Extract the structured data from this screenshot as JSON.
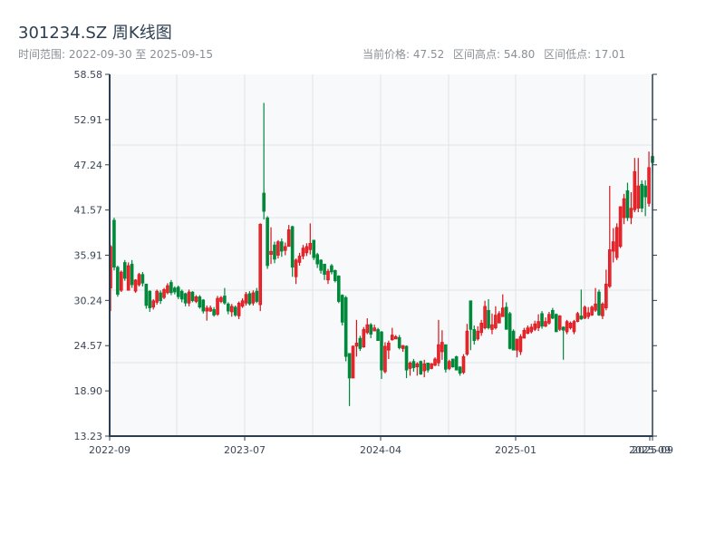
{
  "header": {
    "title": "301234.SZ 周K线图",
    "range_label": "时间范围: 2022-09-30 至 2025-09-15",
    "current_price": "当前价格: 47.52",
    "range_high": "区间高点: 54.80",
    "range_low": "区间低点: 17.01"
  },
  "chart_data": {
    "type": "candlestick",
    "title": "301234.SZ 周K线图",
    "interval": "weekly",
    "date_range": [
      "2022-09-30",
      "2025-09-15"
    ],
    "colors": {
      "up": "#d7141a",
      "down": "#00893a",
      "plot_bg": "#f7f9fb",
      "grid": "#e1e4e8",
      "axis": "#2c3e50"
    },
    "ylim": [
      13.23,
      58.58
    ],
    "y_ticks": [
      "13.23",
      "18.90",
      "24.57",
      "30.24",
      "35.91",
      "41.57",
      "47.24",
      "52.91",
      "58.58"
    ],
    "x_ticks": [
      "2022-09",
      "2023-07",
      "2024-04",
      "2025-01",
      "2025-09",
      "2025-09"
    ],
    "grid": true,
    "fields": [
      "open",
      "high",
      "low",
      "close"
    ],
    "candles": [
      [
        31.8,
        37.2,
        28.9,
        37.0
      ],
      [
        40.3,
        40.6,
        34.0,
        34.4
      ],
      [
        34.4,
        34.6,
        30.7,
        31.0
      ],
      [
        31.5,
        34.0,
        31.3,
        33.8
      ],
      [
        35.0,
        35.3,
        32.7,
        33.0
      ],
      [
        31.5,
        35.0,
        31.5,
        34.6
      ],
      [
        34.8,
        35.3,
        31.8,
        32.2
      ],
      [
        31.4,
        32.9,
        31.2,
        32.8
      ],
      [
        32.2,
        33.7,
        32.0,
        33.5
      ],
      [
        33.5,
        33.8,
        32.0,
        32.4
      ],
      [
        32.3,
        32.3,
        29.2,
        29.6
      ],
      [
        31.4,
        31.5,
        28.8,
        29.3
      ],
      [
        29.4,
        30.4,
        29.1,
        30.2
      ],
      [
        30.0,
        31.6,
        29.7,
        31.4
      ],
      [
        31.2,
        31.5,
        29.8,
        30.2
      ],
      [
        30.6,
        31.8,
        30.4,
        31.6
      ],
      [
        31.2,
        32.4,
        31.0,
        32.1
      ],
      [
        32.5,
        32.8,
        30.9,
        31.2
      ],
      [
        31.8,
        32.0,
        31.0,
        31.3
      ],
      [
        31.9,
        32.1,
        30.4,
        30.7
      ],
      [
        31.4,
        31.6,
        30.0,
        30.4
      ],
      [
        31.1,
        31.2,
        29.5,
        29.9
      ],
      [
        29.9,
        31.6,
        29.5,
        31.3
      ],
      [
        31.3,
        31.4,
        30.0,
        30.2
      ],
      [
        30.1,
        30.9,
        29.9,
        30.7
      ],
      [
        30.7,
        30.9,
        29.2,
        29.4
      ],
      [
        30.3,
        30.4,
        28.6,
        28.9
      ],
      [
        28.9,
        29.6,
        27.7,
        29.3
      ],
      [
        28.9,
        29.6,
        28.8,
        29.3
      ],
      [
        29.1,
        29.4,
        28.2,
        28.4
      ],
      [
        28.5,
        30.8,
        28.3,
        30.5
      ],
      [
        30.1,
        30.8,
        29.9,
        30.6
      ],
      [
        30.8,
        31.8,
        29.7,
        29.9
      ],
      [
        29.8,
        30.0,
        28.5,
        28.9
      ],
      [
        28.8,
        29.8,
        28.2,
        29.5
      ],
      [
        29.4,
        29.6,
        28.2,
        28.4
      ],
      [
        28.3,
        30.1,
        27.9,
        29.9
      ],
      [
        29.5,
        30.5,
        29.3,
        30.2
      ],
      [
        29.9,
        31.3,
        29.6,
        31.0
      ],
      [
        31.1,
        31.4,
        29.6,
        29.8
      ],
      [
        29.9,
        31.5,
        29.6,
        31.2
      ],
      [
        31.4,
        31.8,
        29.9,
        30.1
      ],
      [
        29.7,
        39.9,
        28.9,
        39.8
      ],
      [
        43.7,
        55.0,
        40.4,
        41.4
      ],
      [
        40.6,
        40.8,
        34.2,
        34.6
      ],
      [
        36.0,
        39.4,
        34.8,
        36.4
      ],
      [
        37.2,
        37.6,
        34.9,
        35.4
      ],
      [
        35.9,
        37.8,
        35.5,
        37.6
      ],
      [
        37.6,
        38.0,
        35.7,
        36.4
      ],
      [
        36.5,
        37.5,
        35.9,
        37.0
      ],
      [
        37.0,
        39.7,
        37.0,
        39.1
      ],
      [
        39.5,
        39.6,
        33.2,
        34.4
      ],
      [
        33.2,
        35.5,
        32.3,
        35.3
      ],
      [
        35.0,
        36.2,
        34.6,
        35.8
      ],
      [
        35.8,
        37.2,
        35.4,
        36.8
      ],
      [
        36.2,
        37.4,
        35.8,
        37.0
      ],
      [
        36.6,
        39.9,
        36.0,
        37.4
      ],
      [
        37.8,
        37.8,
        35.3,
        35.6
      ],
      [
        36.0,
        36.2,
        34.3,
        34.8
      ],
      [
        35.3,
        35.4,
        33.6,
        34.0
      ],
      [
        34.8,
        34.8,
        32.8,
        33.5
      ],
      [
        32.8,
        34.2,
        32.3,
        33.9
      ],
      [
        34.6,
        34.8,
        33.5,
        33.8
      ],
      [
        34.0,
        34.1,
        32.5,
        32.7
      ],
      [
        33.3,
        33.4,
        29.9,
        30.1
      ],
      [
        30.9,
        31.0,
        27.1,
        27.5
      ],
      [
        30.6,
        30.8,
        22.6,
        23.2
      ],
      [
        23.6,
        23.6,
        17.0,
        20.5
      ],
      [
        20.5,
        24.6,
        20.5,
        24.5
      ],
      [
        24.5,
        27.8,
        23.2,
        24.9
      ],
      [
        25.5,
        25.8,
        23.9,
        24.2
      ],
      [
        24.4,
        26.9,
        24.3,
        26.6
      ],
      [
        26.2,
        28.0,
        26.0,
        27.2
      ],
      [
        27.2,
        27.4,
        25.5,
        26.0
      ],
      [
        26.4,
        27.2,
        26.4,
        26.8
      ],
      [
        26.6,
        26.8,
        25.2,
        25.2
      ],
      [
        26.3,
        26.4,
        20.4,
        21.5
      ],
      [
        21.3,
        25.0,
        21.1,
        24.5
      ],
      [
        24.0,
        25.2,
        22.9,
        24.9
      ],
      [
        25.3,
        26.8,
        25.2,
        25.9
      ],
      [
        25.4,
        25.9,
        25.4,
        25.7
      ],
      [
        25.6,
        25.9,
        24.1,
        24.3
      ],
      [
        24.2,
        24.6,
        23.8,
        24.6
      ],
      [
        24.5,
        24.6,
        20.5,
        21.5
      ],
      [
        21.7,
        22.6,
        20.8,
        22.4
      ],
      [
        22.6,
        22.9,
        21.3,
        21.8
      ],
      [
        21.9,
        22.5,
        20.8,
        22.3
      ],
      [
        22.6,
        22.7,
        20.9,
        21.0
      ],
      [
        21.4,
        22.8,
        20.6,
        22.3
      ],
      [
        22.4,
        22.4,
        21.2,
        21.5
      ],
      [
        21.7,
        22.4,
        21.6,
        22.3
      ],
      [
        22.1,
        23.1,
        22.0,
        22.9
      ],
      [
        22.4,
        27.8,
        22.0,
        24.7
      ],
      [
        23.8,
        26.5,
        22.8,
        25.0
      ],
      [
        24.7,
        24.7,
        21.2,
        21.6
      ],
      [
        21.7,
        22.8,
        21.5,
        22.6
      ],
      [
        22.9,
        22.9,
        21.8,
        21.9
      ],
      [
        23.2,
        23.3,
        21.5,
        21.5
      ],
      [
        21.9,
        22.0,
        20.8,
        21.1
      ],
      [
        21.2,
        23.5,
        21.0,
        23.2
      ],
      [
        23.5,
        27.3,
        23.3,
        26.4
      ],
      [
        30.2,
        30.2,
        24.0,
        26.6
      ],
      [
        26.6,
        27.1,
        24.7,
        25.2
      ],
      [
        25.4,
        27.0,
        25.2,
        26.4
      ],
      [
        26.2,
        27.8,
        25.8,
        27.4
      ],
      [
        26.8,
        30.2,
        26.6,
        29.5
      ],
      [
        29.0,
        30.4,
        26.6,
        26.8
      ],
      [
        26.6,
        28.6,
        26.0,
        27.2
      ],
      [
        26.8,
        29.5,
        26.6,
        28.4
      ],
      [
        27.4,
        28.9,
        27.4,
        28.6
      ],
      [
        28.2,
        31.0,
        28.2,
        29.3
      ],
      [
        29.4,
        30.0,
        26.6,
        26.6
      ],
      [
        28.6,
        28.8,
        24.1,
        24.2
      ],
      [
        26.4,
        26.6,
        24.0,
        24.0
      ],
      [
        24.0,
        25.4,
        23.1,
        25.4
      ],
      [
        23.8,
        26.0,
        23.4,
        25.7
      ],
      [
        25.5,
        26.8,
        25.5,
        26.5
      ],
      [
        26.1,
        27.1,
        26.0,
        26.8
      ],
      [
        26.3,
        27.3,
        26.1,
        26.9
      ],
      [
        26.6,
        27.7,
        26.4,
        27.3
      ],
      [
        26.8,
        28.5,
        26.4,
        27.6
      ],
      [
        28.6,
        28.9,
        26.7,
        27.0
      ],
      [
        27.0,
        28.1,
        26.9,
        27.6
      ],
      [
        27.4,
        28.8,
        27.2,
        28.5
      ],
      [
        29.0,
        29.3,
        27.9,
        28.0
      ],
      [
        28.5,
        28.6,
        26.3,
        26.3
      ],
      [
        26.6,
        28.4,
        26.4,
        28.3
      ],
      [
        26.9,
        27.0,
        22.8,
        26.5
      ],
      [
        26.3,
        27.8,
        26.0,
        27.6
      ],
      [
        26.8,
        27.6,
        26.6,
        27.4
      ],
      [
        26.3,
        27.8,
        26.0,
        27.6
      ],
      [
        27.6,
        28.8,
        27.5,
        28.6
      ],
      [
        28.3,
        31.6,
        27.8,
        27.9
      ],
      [
        28.0,
        29.6,
        27.9,
        29.4
      ],
      [
        28.2,
        29.4,
        27.9,
        28.7
      ],
      [
        28.4,
        29.6,
        28.3,
        29.4
      ],
      [
        29.0,
        31.8,
        28.8,
        29.8
      ],
      [
        31.3,
        31.6,
        28.3,
        28.4
      ],
      [
        28.3,
        30.0,
        27.9,
        29.8
      ],
      [
        29.3,
        34.1,
        29.0,
        32.3
      ],
      [
        32.0,
        44.6,
        31.8,
        36.6
      ],
      [
        36.4,
        39.3,
        35.0,
        37.6
      ],
      [
        35.6,
        39.9,
        35.3,
        39.4
      ],
      [
        37.0,
        42.0,
        36.8,
        42.0
      ],
      [
        40.6,
        43.6,
        39.8,
        43.0
      ],
      [
        44.0,
        45.0,
        40.2,
        40.6
      ],
      [
        40.6,
        43.8,
        39.8,
        41.8
      ],
      [
        41.6,
        48.1,
        41.3,
        46.4
      ],
      [
        41.8,
        48.1,
        41.3,
        44.6
      ],
      [
        44.8,
        45.3,
        41.3,
        41.8
      ],
      [
        44.6,
        45.3,
        40.8,
        43.2
      ],
      [
        42.4,
        48.9,
        42.0,
        46.9
      ],
      [
        48.3,
        48.5,
        46.3,
        47.52
      ]
    ]
  }
}
